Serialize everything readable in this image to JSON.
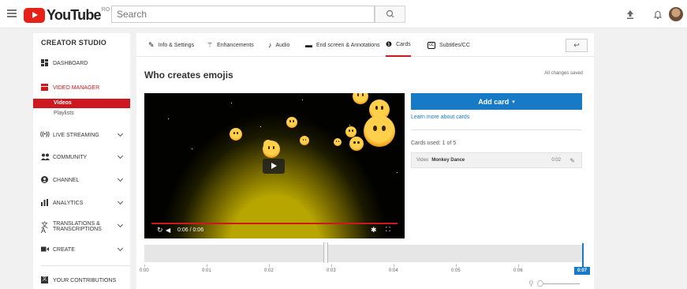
{
  "masthead": {
    "logo_text": "YouTube",
    "country_code": "RO",
    "search_placeholder": "Search",
    "icons": [
      "menu-icon",
      "search-icon",
      "upload-icon",
      "bell-icon"
    ]
  },
  "sidebar": {
    "title": "CREATOR STUDIO",
    "items": [
      {
        "label": "DASHBOARD",
        "icon": "dashboard-icon"
      },
      {
        "label": "VIDEO MANAGER",
        "icon": "video-manager-icon"
      },
      {
        "label": "LIVE STREAMING",
        "icon": "live-icon"
      },
      {
        "label": "COMMUNITY",
        "icon": "community-icon"
      },
      {
        "label": "CHANNEL",
        "icon": "channel-icon"
      },
      {
        "label": "ANALYTICS",
        "icon": "analytics-icon"
      },
      {
        "label": "TRANSLATIONS & TRANSCRIPTIONS",
        "icon": "translate-icon"
      },
      {
        "label": "CREATE",
        "icon": "create-icon"
      },
      {
        "label": "YOUR CONTRIBUTIONS",
        "icon": "contributions-icon"
      }
    ],
    "sub_items": [
      "Videos",
      "Playlists"
    ]
  },
  "tabs": [
    {
      "label": "Info & Settings",
      "icon": "pencil-icon"
    },
    {
      "label": "Enhancements",
      "icon": "magic-wand-icon"
    },
    {
      "label": "Audio",
      "icon": "music-note-icon"
    },
    {
      "label": "End screen & Annotations",
      "icon": "end-screen-icon"
    },
    {
      "label": "Cards",
      "icon": "info-icon"
    },
    {
      "label": "Subtitles/CC",
      "icon": "cc-icon"
    }
  ],
  "video": {
    "title": "Who creates emojis",
    "save_status": "All changes saved",
    "time_display": "0:06 / 0:06",
    "progress": 1.0
  },
  "cards": {
    "add_button": "Add card",
    "learn_more": "Learn more about cards",
    "used_label": "Cards used: 1 of 5",
    "list": [
      {
        "type": "Video",
        "name": "Monkey Dance",
        "time": "0:02"
      }
    ]
  },
  "timeline": {
    "ticks": [
      "0:00",
      "0:01",
      "0:02",
      "0:03",
      "0:04",
      "0:05",
      "0:06"
    ],
    "current": "0:07"
  }
}
